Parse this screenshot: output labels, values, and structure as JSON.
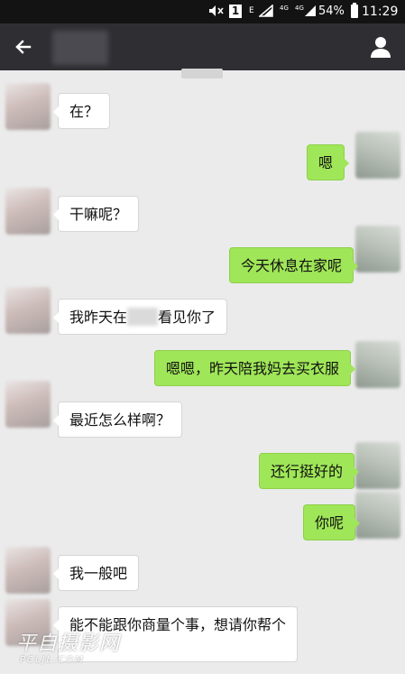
{
  "status_bar": {
    "mute_icon": "mute-icon",
    "notif_digit": "1",
    "net_e": "E",
    "net_4g_1": "4G",
    "net_4g_2": "4G",
    "battery_percent": "54%",
    "time": "11:29"
  },
  "header": {
    "back_icon": "back-arrow-icon",
    "contact_name": "",
    "profile_icon": "person-icon"
  },
  "messages": [
    {
      "side": "left",
      "text": "在？"
    },
    {
      "side": "right",
      "text": "嗯"
    },
    {
      "side": "left",
      "text": "干嘛呢？"
    },
    {
      "side": "right",
      "text": "今天休息在家呢"
    },
    {
      "side": "left",
      "text_before": "我昨天在",
      "text_after": "看见你了"
    },
    {
      "side": "right",
      "text": "嗯嗯，昨天陪我妈去买衣服"
    },
    {
      "side": "left",
      "text": "最近怎么样啊？"
    },
    {
      "side": "right",
      "text": "还行挺好的"
    },
    {
      "side": "right",
      "text": "你呢"
    },
    {
      "side": "left",
      "text": "我一般吧"
    },
    {
      "side": "left",
      "text": "能不能跟你商量个事，想请你帮个"
    }
  ],
  "watermark": {
    "main": "平自摄影网",
    "sub": "PCLJL.COM"
  },
  "colors": {
    "status_bar": "#131313",
    "title_bar": "#2e2e33",
    "chat_bg": "#ebebeb",
    "sent_bubble": "#9fe658",
    "received_bubble": "#ffffff"
  }
}
